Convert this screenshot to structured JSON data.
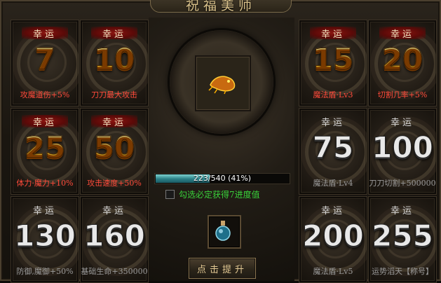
{
  "window": {
    "title": "祝福美师"
  },
  "tiles": [
    {
      "badge": "幸运",
      "value": "7",
      "effect": "攻魔道伤+5%",
      "state": "unlocked"
    },
    {
      "badge": "幸运",
      "value": "10",
      "effect": "刀刀最大攻击",
      "state": "unlocked"
    },
    {
      "badge": "幸运",
      "value": "15",
      "effect": "魔法盾·Lv3",
      "state": "unlocked"
    },
    {
      "badge": "幸运",
      "value": "20",
      "effect": "切割几率+5%",
      "state": "unlocked"
    },
    {
      "badge": "幸运",
      "value": "25",
      "effect": "体力·魔力+10%",
      "state": "unlocked"
    },
    {
      "badge": "幸运",
      "value": "50",
      "effect": "攻击速度+50%",
      "state": "unlocked"
    },
    {
      "badge": "幸运",
      "value": "75",
      "effect": "魔法盾·Lv4",
      "state": "locked"
    },
    {
      "badge": "幸运",
      "value": "100",
      "effect": "刀刀切割+500000",
      "state": "locked"
    },
    {
      "badge": "幸运",
      "value": "130",
      "effect": "防御,魔御+50%",
      "state": "locked"
    },
    {
      "badge": "幸运",
      "value": "160",
      "effect": "基础生命+350000",
      "state": "locked"
    },
    {
      "badge": "幸运",
      "value": "200",
      "effect": "魔法盾·Lv5",
      "state": "locked"
    },
    {
      "badge": "幸运",
      "value": "255",
      "effect": "运势滔天【称号】",
      "state": "locked"
    }
  ],
  "progress": {
    "text": "223/540 (41%)",
    "fraction": 0.41
  },
  "option": {
    "label": "勾选必定获得7进度值",
    "checked": false
  },
  "button": {
    "label": "点击提升"
  },
  "colors": {
    "gold": "#ffd23a",
    "red_effect": "#ff4a3a",
    "green": "#39d13a",
    "bar": "#2a7f86"
  }
}
